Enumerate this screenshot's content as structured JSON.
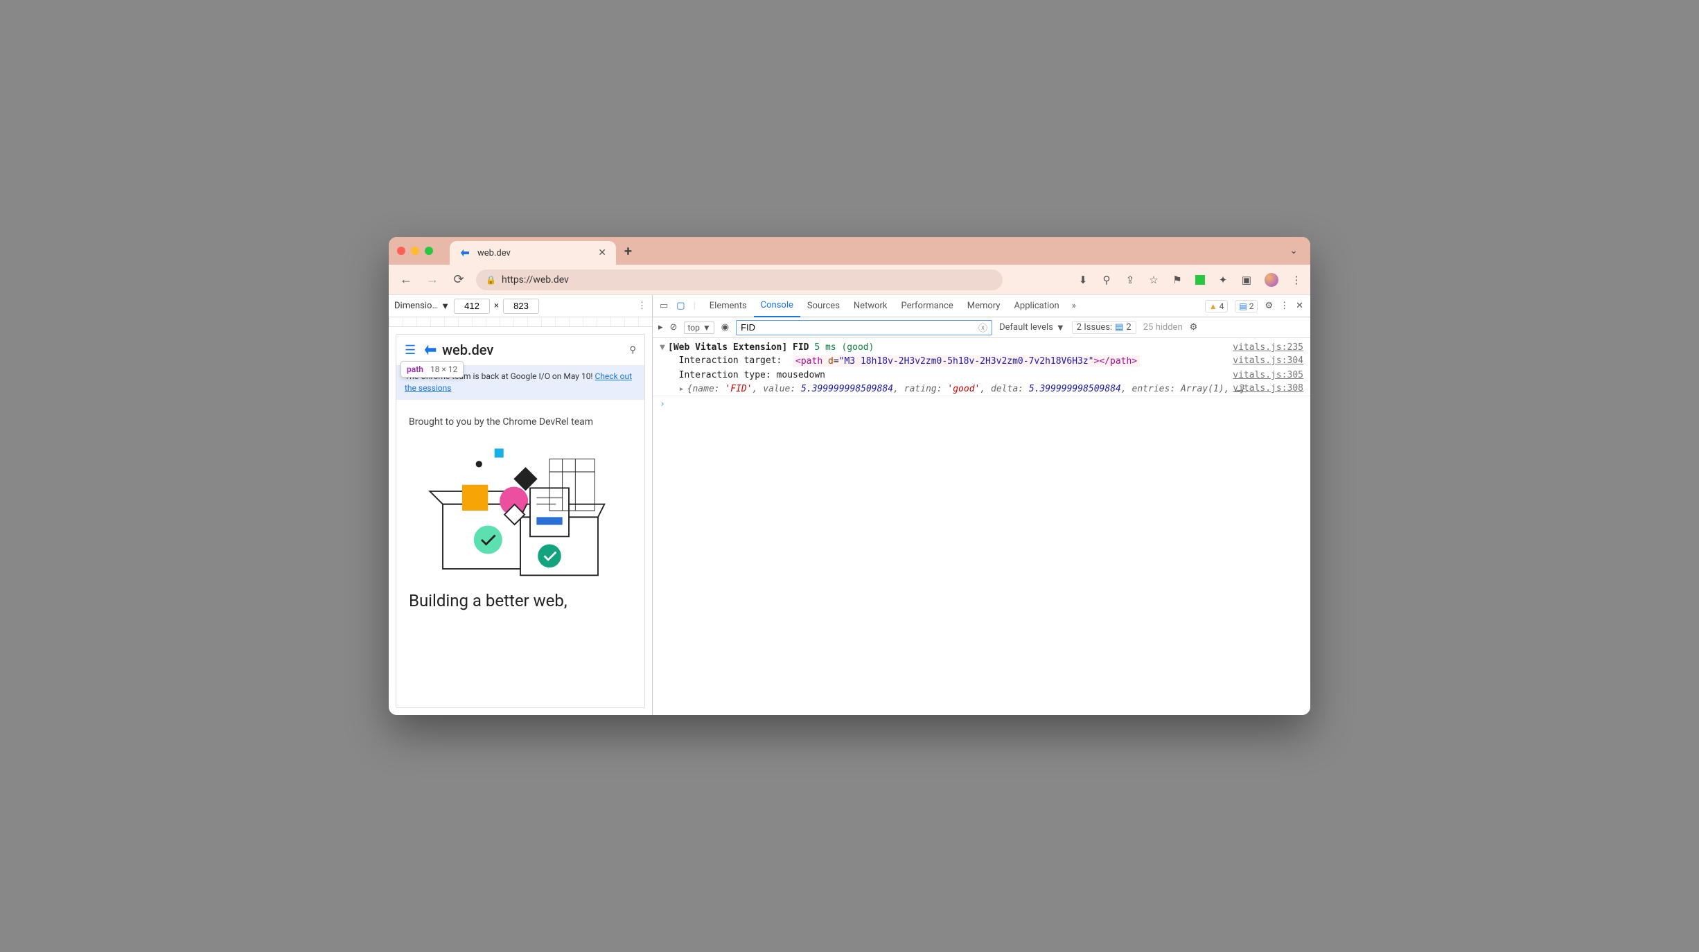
{
  "chrome": {
    "tab_title": "web.dev",
    "url": "https://web.dev",
    "toolbar_icons": [
      "download-icon",
      "zoom-icon",
      "share-icon",
      "star-icon",
      "flag-icon",
      "extension-square-icon",
      "extensions-icon",
      "side-panel-icon",
      "avatar-icon",
      "more-icon"
    ]
  },
  "device_toolbar": {
    "label": "Dimensio…",
    "width": "412",
    "sep": "×",
    "height": "823"
  },
  "webdev": {
    "brand": "web.dev",
    "tooltip_el": "path",
    "tooltip_size": "18 × 12",
    "banner_text": "The Chrome team is back at Google I/O on May 10! ",
    "banner_link": "Check out the sessions",
    "brought": "Brought to you by the Chrome DevRel team",
    "headline": "Building a better web,"
  },
  "devtools": {
    "tabs": [
      "Elements",
      "Console",
      "Sources",
      "Network",
      "Performance",
      "Memory",
      "Application"
    ],
    "active_tab": "Console",
    "warn_count": "4",
    "issue_count": "2",
    "console_bar": {
      "context": "top",
      "filter_value": "FID",
      "levels": "Default levels",
      "issues_label": "2 Issues:",
      "issues_count": "2",
      "hidden": "25 hidden"
    },
    "console": {
      "line1_prefix": "[Web Vitals Extension] FID ",
      "line1_value": "5 ms (good)",
      "src1": "vitals.js:235",
      "line2_label": "Interaction target: ",
      "line2_html_open": "<path ",
      "line2_attr_name": "d",
      "line2_attr_eq": "=",
      "line2_attr_val": "\"M3 18h18v-2H3v2zm0-5h18v-2H3v2zm0-7v2h18V6H3z\"",
      "line2_html_close": "></path>",
      "src2": "vitals.js:304",
      "line3": "Interaction type: mousedown",
      "src3": "vitals.js:305",
      "src4": "vitals.js:308",
      "obj_open": "{",
      "obj_name_k": "name: ",
      "obj_name_v": "'FID'",
      "obj_sep": ", ",
      "obj_value_k": "value: ",
      "obj_value_v": "5.399999998509884",
      "obj_rating_k": "rating: ",
      "obj_rating_v": "'good'",
      "obj_delta_k": "delta: ",
      "obj_delta_v": "5.399999998509884",
      "obj_entries_k": "entries: ",
      "obj_entries_v": "Array(1)",
      "obj_rest": ", …}"
    }
  }
}
